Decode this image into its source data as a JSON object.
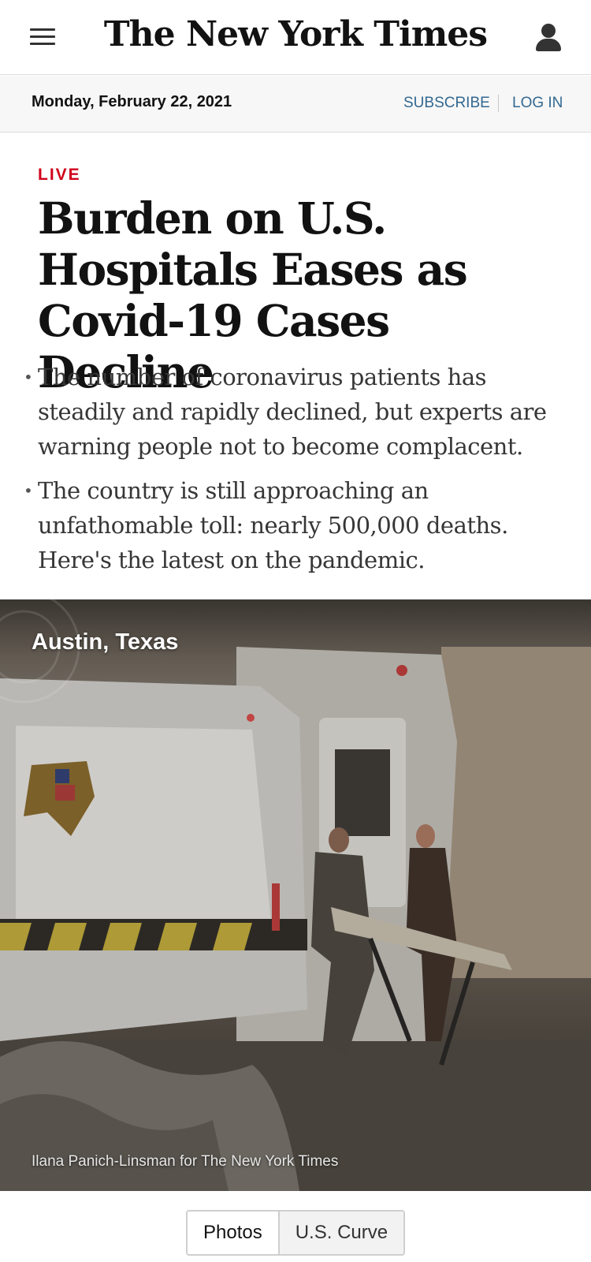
{
  "header": {
    "logo": "The New York Times",
    "menu_icon": "hamburger-menu-icon",
    "user_icon": "user-account-icon"
  },
  "datebar": {
    "date": "Monday, February 22, 2021",
    "subscribe_label": "SUBSCRIBE",
    "login_label": "LOG IN"
  },
  "article": {
    "live_label": "LIVE",
    "headline": "Burden on U.S. Hospitals Eases as Covid-19 Cases Decline",
    "bullets": [
      "The number of coronavirus patients has steadily and rapidly declined, but experts are warning people not to become complacent.",
      "The country is still approaching an unfathomable toll: nearly 500,000 deaths. Here's the latest on the pandemic."
    ]
  },
  "media": {
    "location": "Austin, Texas",
    "credit": "Ilana Panich-Linsman for The New York Times"
  },
  "tabs": [
    {
      "label": "Photos",
      "selected": true
    },
    {
      "label": "U.S. Curve",
      "selected": false
    }
  ],
  "colors": {
    "live_red": "#d0021b",
    "link_blue": "#326891"
  }
}
